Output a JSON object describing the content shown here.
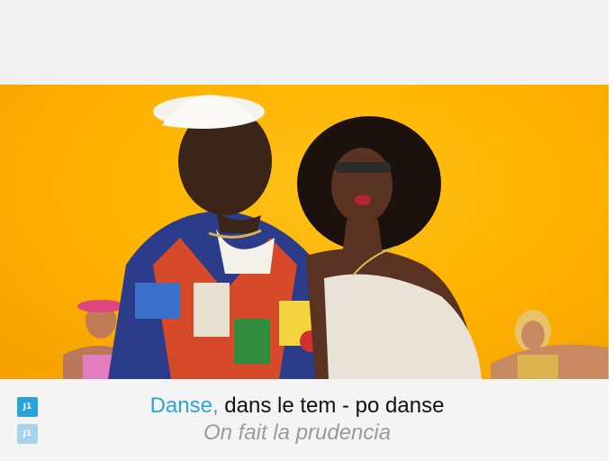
{
  "players": {
    "p1_label": "J1",
    "p2_label": "J1"
  },
  "lyrics": {
    "current_sung": "Danse,",
    "current_unsung": " dans le tem - po danse",
    "next_line": "On fait la prudencia"
  },
  "colors": {
    "sung_highlight": "#2aa3dc",
    "unsung_text": "#111111",
    "next_line_text": "#9b9b9b",
    "video_background": "#ffb400"
  }
}
